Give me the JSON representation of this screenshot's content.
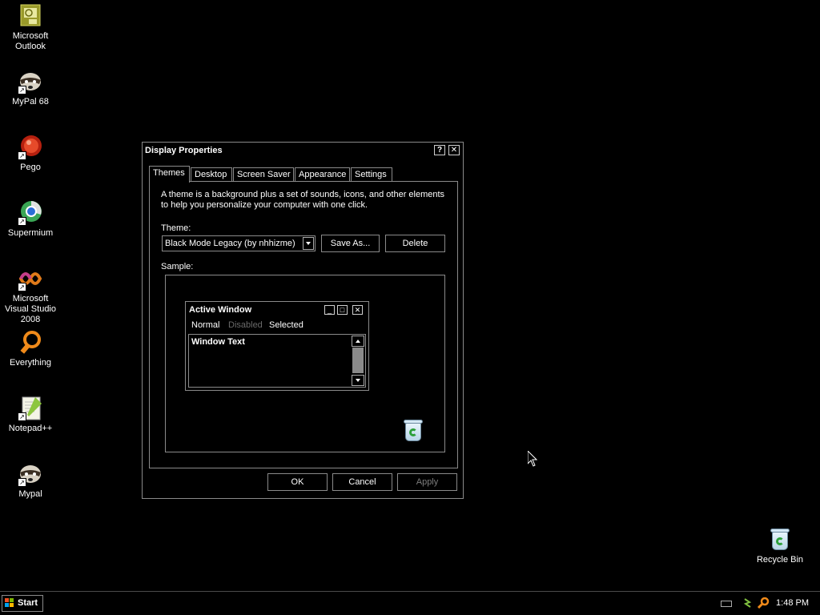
{
  "desktop": {
    "icons": [
      {
        "label": "Microsoft Outlook",
        "icon": "outlook-icon"
      },
      {
        "label": "MyPal 68",
        "icon": "raccoon-icon"
      },
      {
        "label": "Pego",
        "icon": "pego-icon"
      },
      {
        "label": "Supermium",
        "icon": "supermium-icon"
      },
      {
        "label": "Microsoft Visual Studio 2008",
        "icon": "visual-studio-icon"
      },
      {
        "label": "Everything",
        "icon": "everything-icon"
      },
      {
        "label": "Notepad++",
        "icon": "notepadpp-icon"
      },
      {
        "label": "Mypal",
        "icon": "raccoon-icon"
      },
      {
        "label": "Recycle Bin",
        "icon": "recycle-bin-icon"
      }
    ]
  },
  "dialog": {
    "title": "Display Properties",
    "help_glyph": "?",
    "close_glyph": "✕",
    "tabs": [
      "Themes",
      "Desktop",
      "Screen Saver",
      "Appearance",
      "Settings"
    ],
    "active_tab": "Themes",
    "description": "A theme is a background plus a set of sounds, icons, and other elements to help you personalize your computer with one click.",
    "theme_label": "Theme:",
    "theme_value": "Black Mode Legacy (by nhhizme)",
    "save_as_label": "Save As...",
    "delete_label": "Delete",
    "sample_label": "Sample:",
    "sample": {
      "window_title": "Active Window",
      "menu": [
        "Normal",
        "Disabled",
        "Selected"
      ],
      "window_text": "Window Text"
    },
    "ok_label": "OK",
    "cancel_label": "Cancel",
    "apply_label": "Apply"
  },
  "taskbar": {
    "start_label": "Start",
    "clock": "1:48 PM"
  },
  "colors": {
    "background": "#000000",
    "text": "#ffffff",
    "border": "#8a8a8a",
    "disabled_text": "#7d7d7d"
  }
}
